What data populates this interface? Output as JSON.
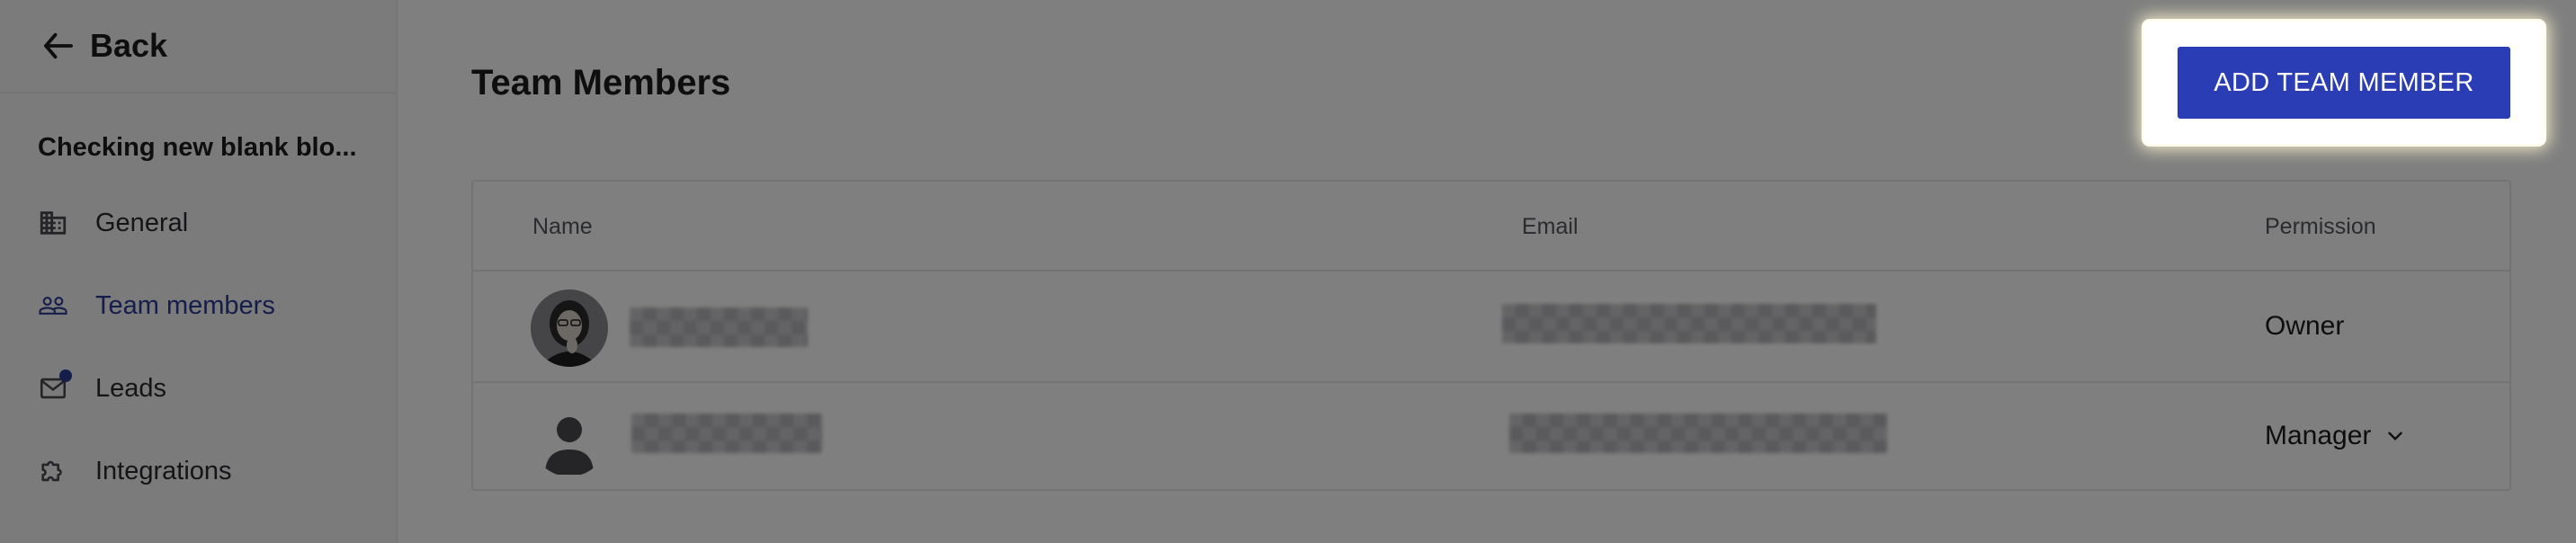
{
  "sidebar": {
    "back_label": "Back",
    "project_name": "Checking new blank blo...",
    "items": [
      {
        "label": "General",
        "icon": "building-icon",
        "active": false
      },
      {
        "label": "Team members",
        "icon": "people-icon",
        "active": true
      },
      {
        "label": "Leads",
        "icon": "mail-icon",
        "active": false,
        "has_notification": true
      },
      {
        "label": "Integrations",
        "icon": "puzzle-icon",
        "active": false
      }
    ]
  },
  "main": {
    "title": "Team Members",
    "add_button_label": "ADD TEAM MEMBER",
    "table": {
      "columns": [
        "Name",
        "Email",
        "Permission"
      ],
      "rows": [
        {
          "avatar": "photo",
          "permission": "Owner",
          "editable": false
        },
        {
          "avatar": "default-person-icon",
          "permission": "Manager",
          "editable": true
        }
      ]
    }
  },
  "colors": {
    "accent": "#2b3db4",
    "active_nav": "#2b3a94",
    "overlay": "rgba(0,0,0,0.5)"
  }
}
